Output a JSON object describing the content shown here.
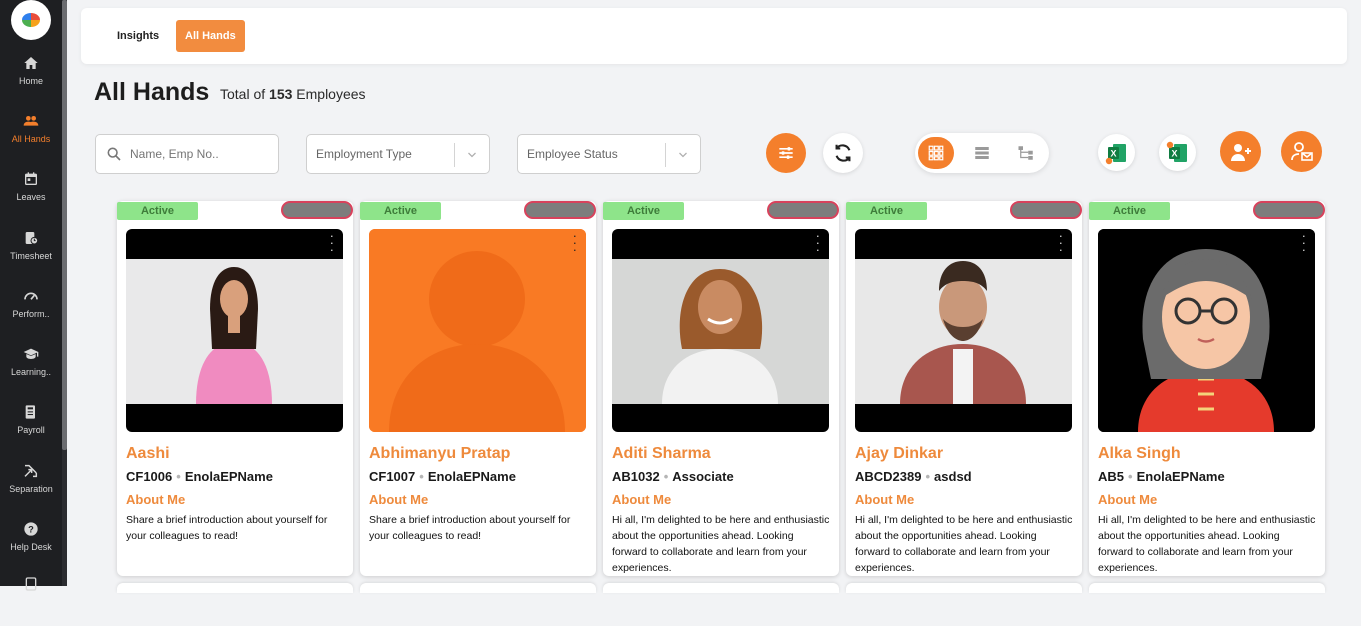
{
  "sidebar": {
    "items": [
      {
        "label": "Home",
        "icon": "home-icon"
      },
      {
        "label": "All Hands",
        "icon": "people-icon",
        "active": true
      },
      {
        "label": "Leaves",
        "icon": "calendar-icon"
      },
      {
        "label": "Timesheet",
        "icon": "timesheet-icon"
      },
      {
        "label": "Perform..",
        "icon": "gauge-icon"
      },
      {
        "label": "Learning..",
        "icon": "graduation-cap-icon"
      },
      {
        "label": "Payroll",
        "icon": "payroll-icon"
      },
      {
        "label": "Separation",
        "icon": "separation-arrows-icon"
      },
      {
        "label": "Help Desk",
        "icon": "help-icon"
      }
    ]
  },
  "tabs": {
    "insights": "Insights",
    "all_hands": "All Hands"
  },
  "header": {
    "title": "All Hands",
    "total_prefix": "Total of",
    "total_count": "153",
    "total_suffix": "Employees"
  },
  "filters": {
    "search_placeholder": "Name, Emp No..",
    "employment_type_placeholder": "Employment Type",
    "employee_status_placeholder": "Employee Status"
  },
  "colors": {
    "accent": "#f47f2c",
    "active_badge": "#8ee48a",
    "sidebar": "#1e1f22"
  },
  "employees": [
    {
      "status": "Active",
      "name": "Aashi",
      "emp_no": "CF1006",
      "designation": "EnolaEPName",
      "about_label": "About Me",
      "about": "Share a brief introduction about yourself for your colleagues to read!"
    },
    {
      "status": "Active",
      "name": "Abhimanyu Pratap",
      "emp_no": "CF1007",
      "designation": "EnolaEPName",
      "about_label": "About Me",
      "about": "Share a brief introduction about yourself for your colleagues to read!"
    },
    {
      "status": "Active",
      "name": "Aditi Sharma",
      "emp_no": "AB1032",
      "designation": "Associate",
      "about_label": "About Me",
      "about": "Hi all, I'm delighted to be here and enthusiastic about the opportunities ahead. Looking forward to collaborate and learn from your experiences."
    },
    {
      "status": "Active",
      "name": "Ajay Dinkar",
      "emp_no": "ABCD2389",
      "designation": "asdsd",
      "about_label": "About Me",
      "about": "Hi all, I'm delighted to be here and enthusiastic about the opportunities ahead. Looking forward to collaborate and learn from your experiences."
    },
    {
      "status": "Active",
      "name": "Alka Singh",
      "emp_no": "AB5",
      "designation": "EnolaEPName",
      "about_label": "About Me",
      "about": "Hi all, I'm delighted to be here and enthusiastic about the opportunities ahead. Looking forward to collaborate and learn from your experiences."
    }
  ]
}
